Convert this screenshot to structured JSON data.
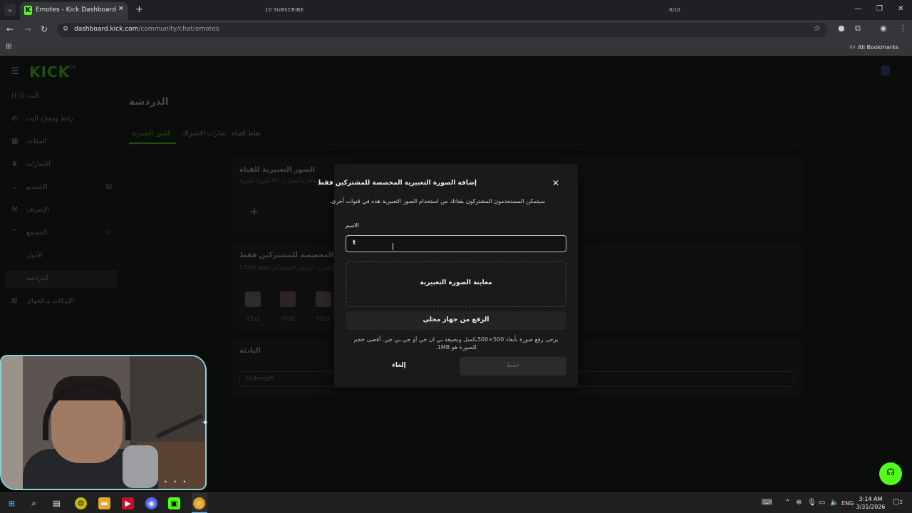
{
  "browser": {
    "tab_title": "Emotes - Kick Dashboard",
    "tab_favicon": "K",
    "overlay_subscribe": "10 SUBSCRIBE",
    "overlay_count": "0/10",
    "url_host": "dashboard.kick.com",
    "url_path": "/community/chat/emotes",
    "all_bookmarks": "All Bookmarks",
    "accent": "#53fc18"
  },
  "sidebar": {
    "logo": "KICK",
    "logo_sup": "BETA",
    "items": [
      {
        "label": "البث",
        "icon": "broadcast-icon"
      },
      {
        "label": "رابط ومفتاح البث",
        "icon": "link-icon"
      },
      {
        "label": "المقاعد",
        "icon": "grid-icon"
      },
      {
        "label": "الإنجازات",
        "icon": "trophy-icon"
      },
      {
        "label": "الاستديو",
        "icon": "chevron-down-icon"
      },
      {
        "label": "الإشراف",
        "icon": "hammer-icon"
      },
      {
        "label": "المجتمع",
        "icon": "chevron-up-icon"
      },
      {
        "label": "الأدوار",
        "icon": ""
      },
      {
        "label": "الدردشة",
        "icon": ""
      },
      {
        "label": "الإنزالات و الجوائز",
        "icon": "gift-icon"
      }
    ]
  },
  "main": {
    "title": "الدردشة",
    "tabs": [
      "الصور التعبيرية",
      "شارات الاشتراك",
      "نقاط القناة"
    ],
    "channel_emotes": {
      "title": "الصور التعبيرية للقناة",
      "subtitle": "يسمح باضافة ما يصل ل 60 صورة تعبيرية"
    },
    "sub_emotes": {
      "title": "الصور التعبيرية المخصصة للمشتركين فقط",
      "subtitle": "57/60 الصور التعبيرية لرسوم المشتركين فقط",
      "emotes": [
        "t7s1",
        "t7s2",
        "t7s3"
      ]
    },
    "prefix": {
      "title": "البادئة",
      "value": "to3mozh"
    }
  },
  "modal": {
    "title": "إضافة الصورة التعبيرية المخصصة للمشتركين فقط",
    "description": "سيتمكن المستخدمون المشتركون بقناتك من استخدام الصور التعبيرية هذه في قنوات أخرى.",
    "name_label": "الاسم",
    "name_value": "t",
    "preview_label": "معاينة الصورة التعبيرية",
    "upload_label": "الرفع من جهاز محلي",
    "hint": "يرجى رفع صورة بأبعاد 500×500بكسل وبصيغة بي ان جي أو جي بي جي. أقصى حجم للصورة هو 1MB.",
    "cancel_label": "إلغاء",
    "save_label": "حفظ"
  },
  "taskbar": {
    "time": "3:14 AM",
    "date": "3/31/2026",
    "lang": "ENG",
    "notifications": "2"
  }
}
